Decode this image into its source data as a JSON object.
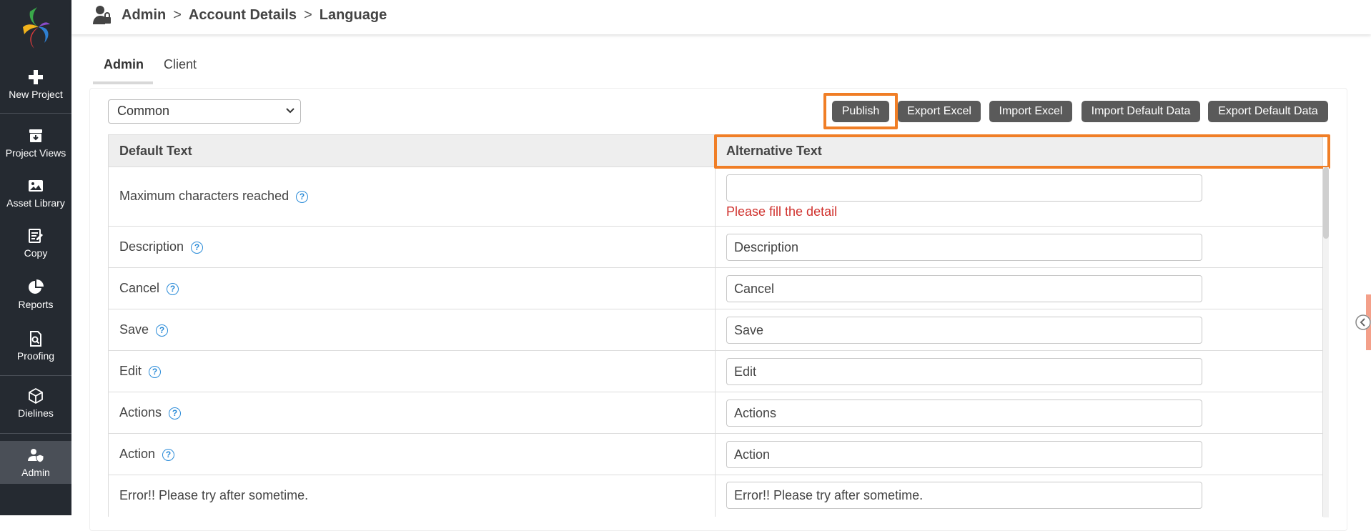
{
  "sidebar": {
    "items": [
      {
        "label": "New Project",
        "icon": "plus-icon"
      },
      {
        "label": "Project Views",
        "icon": "archive-icon"
      },
      {
        "label": "Asset Library",
        "icon": "image-icon"
      },
      {
        "label": "Copy",
        "icon": "edit-document-icon"
      },
      {
        "label": "Reports",
        "icon": "pie-chart-icon"
      },
      {
        "label": "Proofing",
        "icon": "search-document-icon"
      },
      {
        "label": "Dielines",
        "icon": "box-icon"
      },
      {
        "label": "Admin",
        "icon": "user-shield-icon",
        "active": true
      }
    ]
  },
  "header": {
    "breadcrumb": [
      "Admin",
      "Account Details",
      "Language"
    ],
    "separator": ">"
  },
  "tabs": [
    {
      "label": "Admin",
      "active": true
    },
    {
      "label": "Client",
      "active": false
    }
  ],
  "toolbar": {
    "select_value": "Common",
    "buttons": [
      "Publish",
      "Export Excel",
      "Import Excel",
      "Import Default Data",
      "Export Default Data"
    ]
  },
  "table": {
    "headers": [
      "Default Text",
      "Alternative Text"
    ],
    "rows": [
      {
        "label": "Maximum characters reached",
        "help": true,
        "value": "",
        "error": "Please fill the detail"
      },
      {
        "label": "Description",
        "help": true,
        "value": "Description"
      },
      {
        "label": "Cancel",
        "help": true,
        "value": "Cancel"
      },
      {
        "label": "Save",
        "help": true,
        "value": "Save"
      },
      {
        "label": "Edit",
        "help": true,
        "value": "Edit"
      },
      {
        "label": "Actions",
        "help": true,
        "value": "Actions"
      },
      {
        "label": "Action",
        "help": true,
        "value": "Action"
      },
      {
        "label": "Error!! Please try after sometime.",
        "help": false,
        "value": "Error!! Please try after sometime."
      }
    ]
  },
  "help_glyph": "?",
  "colors": {
    "sidebar_bg": "#252a31",
    "highlight": "#f07e26",
    "button_bg": "#5a5a5a",
    "error": "#d0312d",
    "help": "#2a8bd8"
  }
}
